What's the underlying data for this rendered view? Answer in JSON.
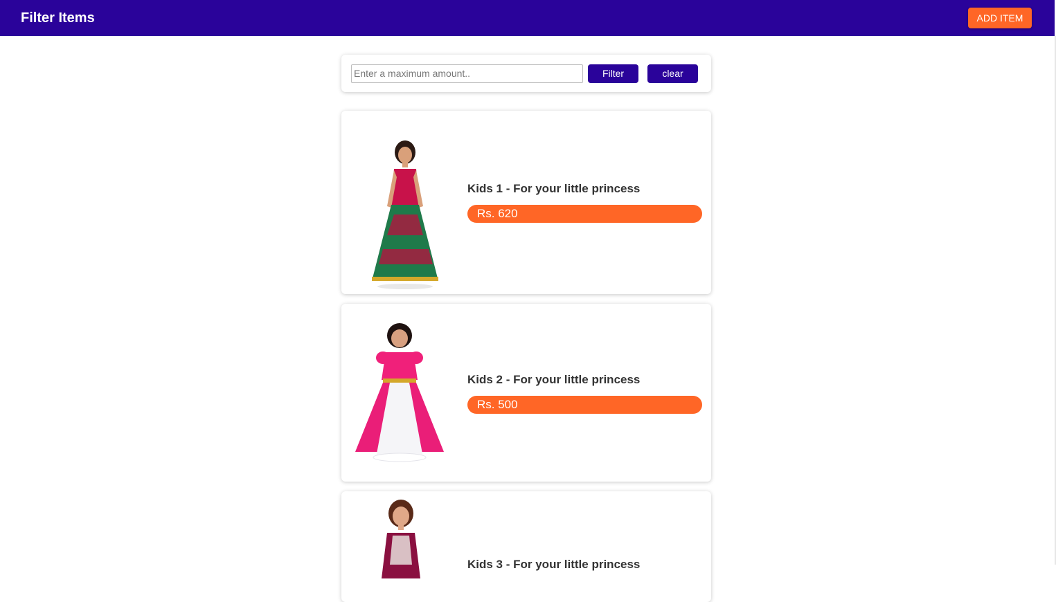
{
  "header": {
    "title": "Filter Items",
    "add_label": "ADD ITEM"
  },
  "filter": {
    "placeholder": "Enter a maximum amount..",
    "value": "",
    "filter_label": "Filter",
    "clear_label": "clear"
  },
  "items": [
    {
      "title": "Kids 1 - For your little princess",
      "price": "Rs. 620"
    },
    {
      "title": "Kids 2 - For your little princess",
      "price": "Rs. 500"
    },
    {
      "title": "Kids 3 - For your little princess",
      "price": ""
    }
  ],
  "colors": {
    "primary": "#2a039a",
    "accent": "#ff6626"
  }
}
